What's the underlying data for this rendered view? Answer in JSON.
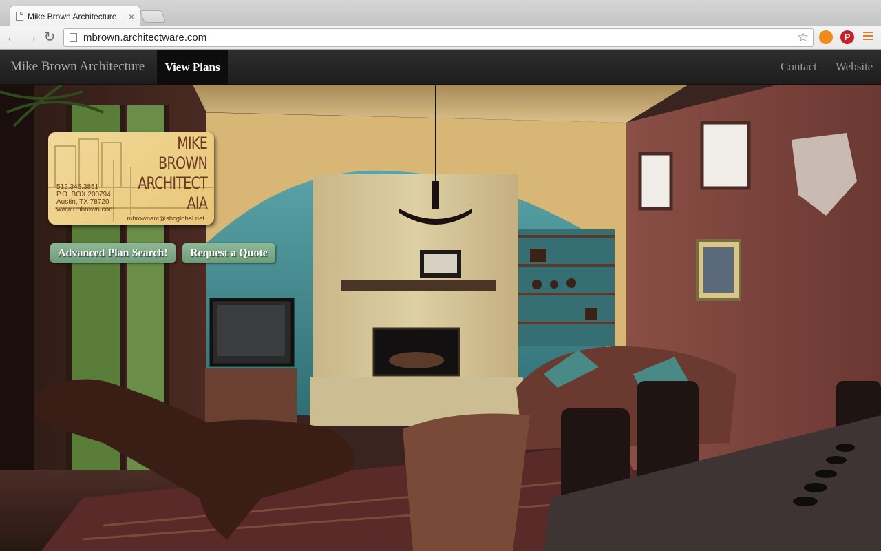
{
  "browser": {
    "tab_title": "Mike Brown Architecture",
    "tab_close": "×",
    "url": "mbrown.architectware.com",
    "back_icon": "←",
    "forward_icon": "→",
    "reload_icon": "↻",
    "star_icon": "☆"
  },
  "nav": {
    "brand": "Mike Brown Architecture",
    "active_item": "View Plans",
    "right_items": [
      "Contact",
      "Website"
    ]
  },
  "card": {
    "logo_lines": [
      "MIKE",
      "BROWN",
      "ARCHITECT",
      "AIA"
    ],
    "phone": "512.346.3851",
    "po_box": "P.O. BOX 200794",
    "city": "Austin, TX  78720",
    "web": "www.rmbrown.com",
    "email": "mbrownarc@sbcglobal.net"
  },
  "buttons": {
    "search": "Advanced Plan Search!",
    "quote": "Request a Quote"
  }
}
